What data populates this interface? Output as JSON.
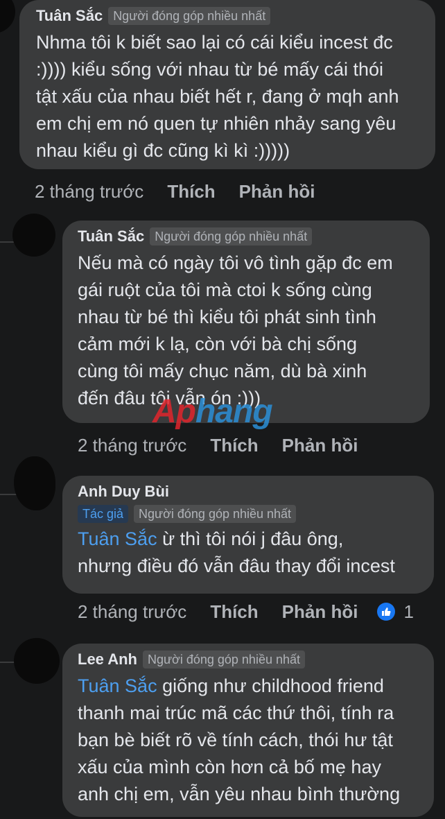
{
  "comments": [
    {
      "author": "Tuân Sắc",
      "badges": [
        "Người đóng góp nhiều nhất"
      ],
      "lines": [
        "Nhma tôi k biết sao lại có cái kiểu incest đc",
        ":)))) kiểu sống với nhau từ bé mấy cái thói",
        "tật xấu của nhau biết hết r, đang ở mqh anh",
        "em chị em nó quen tự nhiên nhảy sang yêu",
        "nhau kiểu gì đc cũng kì kì :)))))"
      ],
      "time": "2 tháng trước",
      "like": "Thích",
      "reply": "Phản hồi"
    },
    {
      "author": "Tuân Sắc",
      "badges": [
        "Người đóng góp nhiều nhất"
      ],
      "lines": [
        "Nếu mà có ngày tôi vô tình gặp đc em",
        "gái ruột của tôi mà ctoi k sống cùng",
        "nhau từ bé thì kiểu tôi phát sinh tình",
        "cảm mới k lạ, còn với bà chị sống",
        "cùng tôi mấy chục năm, dù bà xinh",
        "đến đâu tôi vẫn ón :)))"
      ],
      "time": "2 tháng trước",
      "like": "Thích",
      "reply": "Phản hồi"
    },
    {
      "author": "Anh Duy Bùi",
      "badges": [
        "Tác giả",
        "Người đóng góp nhiều nhất"
      ],
      "mention": "Tuân Sắc",
      "line1_rest": " ừ thì tôi nói j đâu ông,",
      "line2": "nhưng điều đó vẫn đâu thay đổi incest",
      "time": "2 tháng trước",
      "like": "Thích",
      "reply": "Phản hồi",
      "reaction_count": "1"
    },
    {
      "author": "Lee Anh",
      "badges": [
        "Người đóng góp nhiều nhất"
      ],
      "mention": "Tuân Sắc",
      "line1_rest": " giống như childhood friend",
      "lines_rest": [
        "thanh mai trúc mã các thứ thôi, tính ra",
        "bạn bè biết rõ về tính cách, thói hư tật",
        "xấu của mình còn hơn cả bố mẹ hay",
        "anh chị em, vẫn yêu nhau bình thường"
      ]
    }
  ],
  "watermark": {
    "part1": "Ap",
    "part2": "hang"
  },
  "colors": {
    "background": "#18191a",
    "bubble": "#3a3b3c",
    "link": "#4d9ff0",
    "like": "#1877f2"
  },
  "icons": [
    "like-thumb-icon"
  ]
}
